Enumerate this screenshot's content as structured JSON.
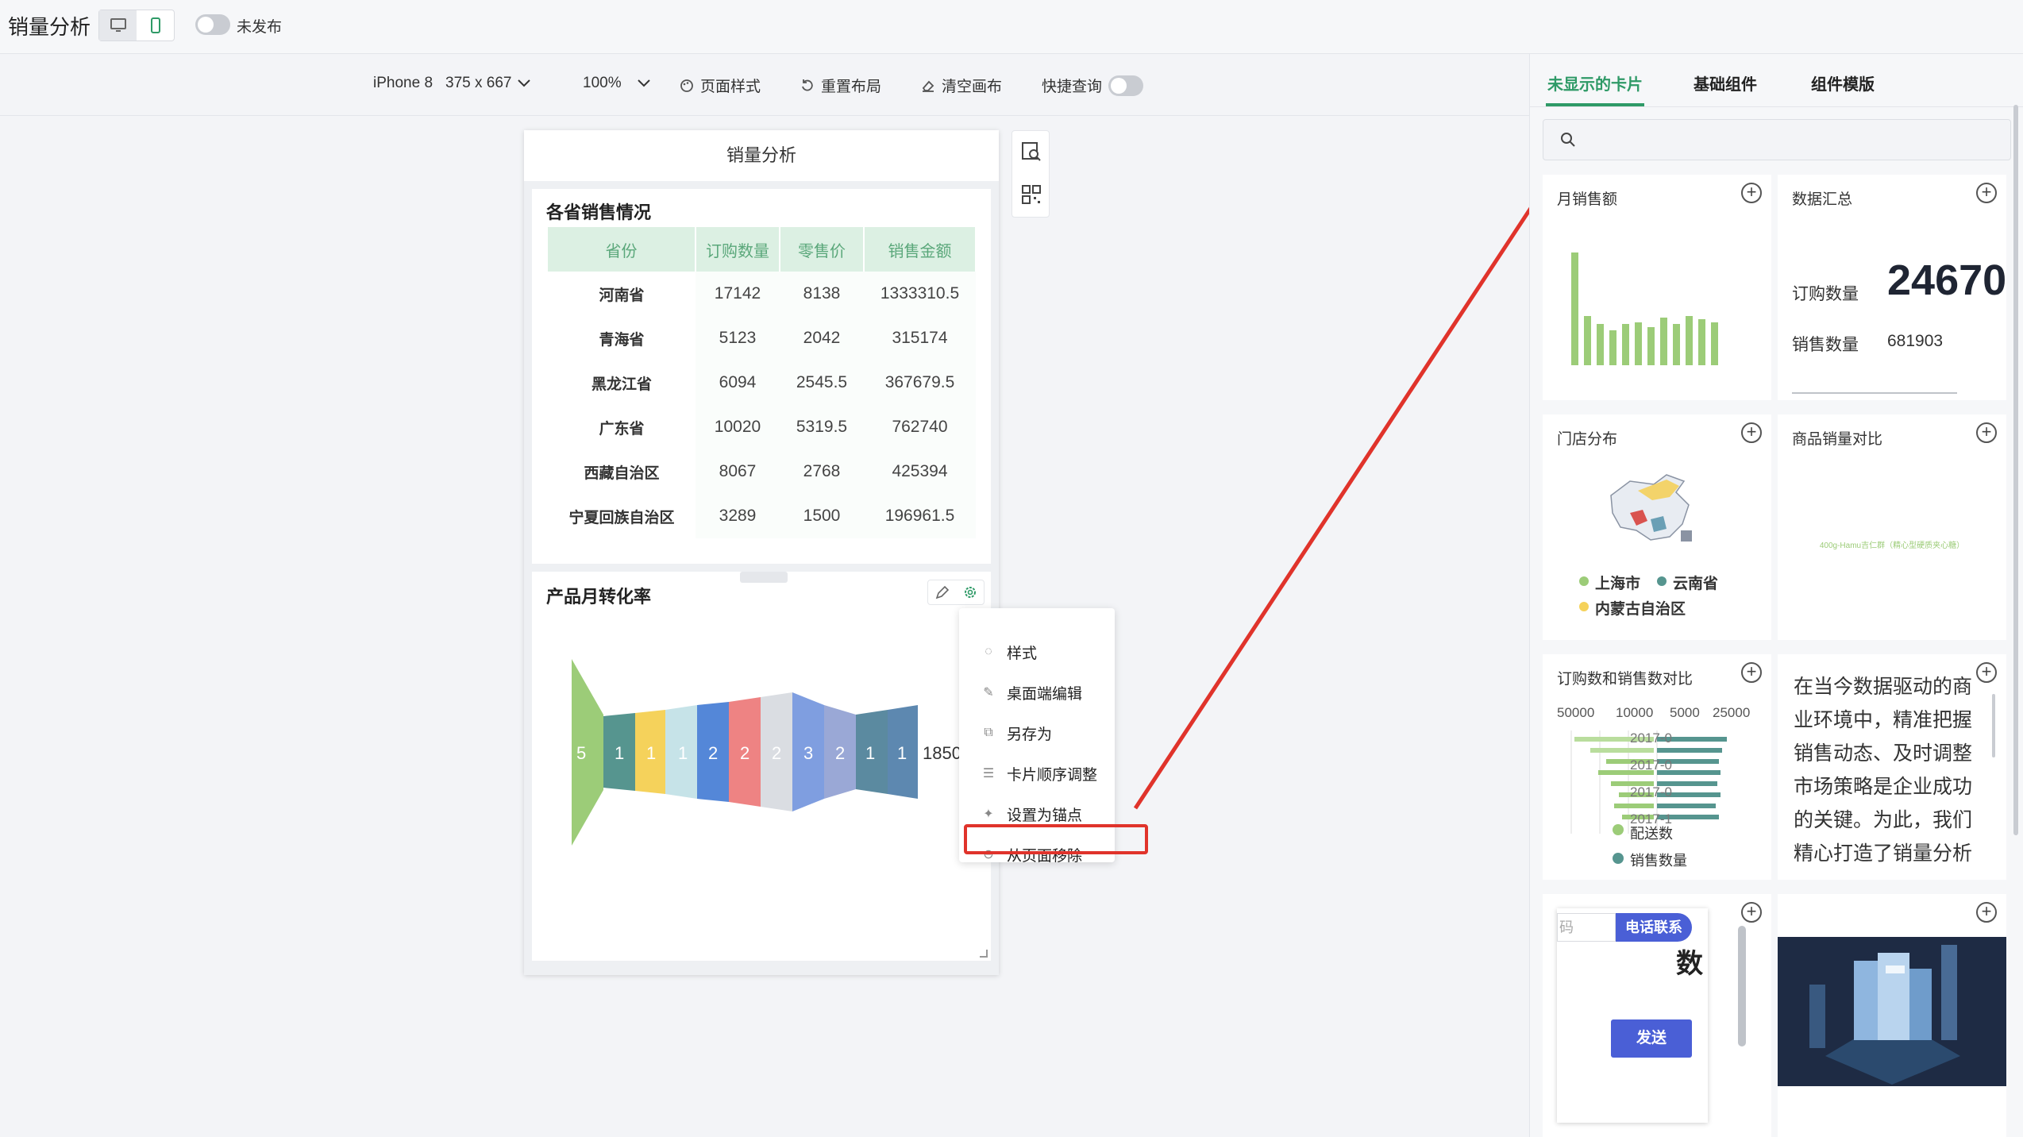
{
  "app": {
    "title": "销量分析",
    "publish_label": "未发布"
  },
  "toolbar": {
    "device": "iPhone 8",
    "resolution": "375 x 667",
    "zoom": "100%",
    "page_style": "页面样式",
    "reset_layout": "重置布局",
    "clear_canvas": "清空画布",
    "quick_query": "快捷查询"
  },
  "phone": {
    "header": "销量分析",
    "table_card": {
      "title": "各省销售情况",
      "columns": [
        "省份",
        "订购数量",
        "零售价",
        "销售金额"
      ],
      "rows": [
        [
          "河南省",
          "17142",
          "8138",
          "1333310.5"
        ],
        [
          "青海省",
          "5123",
          "2042",
          "315174"
        ],
        [
          "黑龙江省",
          "6094",
          "2545.5",
          "367679.5"
        ],
        [
          "广东省",
          "10020",
          "5319.5",
          "762740"
        ],
        [
          "西藏自治区",
          "8067",
          "2768",
          "425394"
        ],
        [
          "宁夏回族自治区",
          "3289",
          "1500",
          "196961.5"
        ]
      ]
    },
    "funnel_card": {
      "title": "产品月转化率",
      "labels": [
        "5",
        "1",
        "1",
        "1",
        "2",
        "2",
        "2",
        "3",
        "2",
        "1",
        "1",
        "1850"
      ]
    }
  },
  "context_menu": {
    "items": [
      {
        "label": "样式",
        "icon": "palette-icon"
      },
      {
        "label": "桌面端编辑",
        "icon": "edit-icon"
      },
      {
        "label": "另存为",
        "icon": "copy-icon"
      },
      {
        "label": "卡片顺序调整",
        "icon": "sort-icon"
      },
      {
        "label": "设置为锚点",
        "icon": "pin-icon"
      },
      {
        "label": "从页面移除",
        "icon": "remove-icon"
      }
    ]
  },
  "right_panel": {
    "tabs": [
      "未显示的卡片",
      "基础组件",
      "组件模版"
    ],
    "cards": {
      "monthly_sales": {
        "title": "月销售额"
      },
      "summary": {
        "title": "数据汇总",
        "order_label": "订购数量",
        "order_value": "24670",
        "sales_label": "销售数量",
        "sales_value": "681903"
      },
      "store_map": {
        "title": "门店分布",
        "legend": [
          "上海市",
          "云南省",
          "内蒙古自治区"
        ]
      },
      "product_compare": {
        "title": "商品销量对比",
        "caption": "400g-Hamu吉仁群（精心型硬质夹心糖）"
      },
      "order_vs_sales": {
        "title": "订购数和销售数对比",
        "axis_ticks": [
          "50000",
          "10000",
          "5000",
          "25000"
        ],
        "rows": [
          "2017-0",
          "2017-0",
          "2017-0",
          "2017-1"
        ],
        "legend_1": "配送数",
        "legend_2": "销售数量"
      },
      "text_card": {
        "text": "在当今数据驱动的商业环境中，精准把握销售动态、及时调整市场策略是企业成功的关键。为此，我们精心打造了销量分析系统，帮助企业分析"
      },
      "contact_card": {
        "input_placeholder": "码",
        "phone_btn": "电话联系",
        "send_btn": "发送",
        "partial_text": "数"
      },
      "image_card": {}
    }
  },
  "colors": {
    "accent": "#2f9a67",
    "annotation_red": "#e0332b",
    "table_head_bg": "#dcf0e3"
  }
}
